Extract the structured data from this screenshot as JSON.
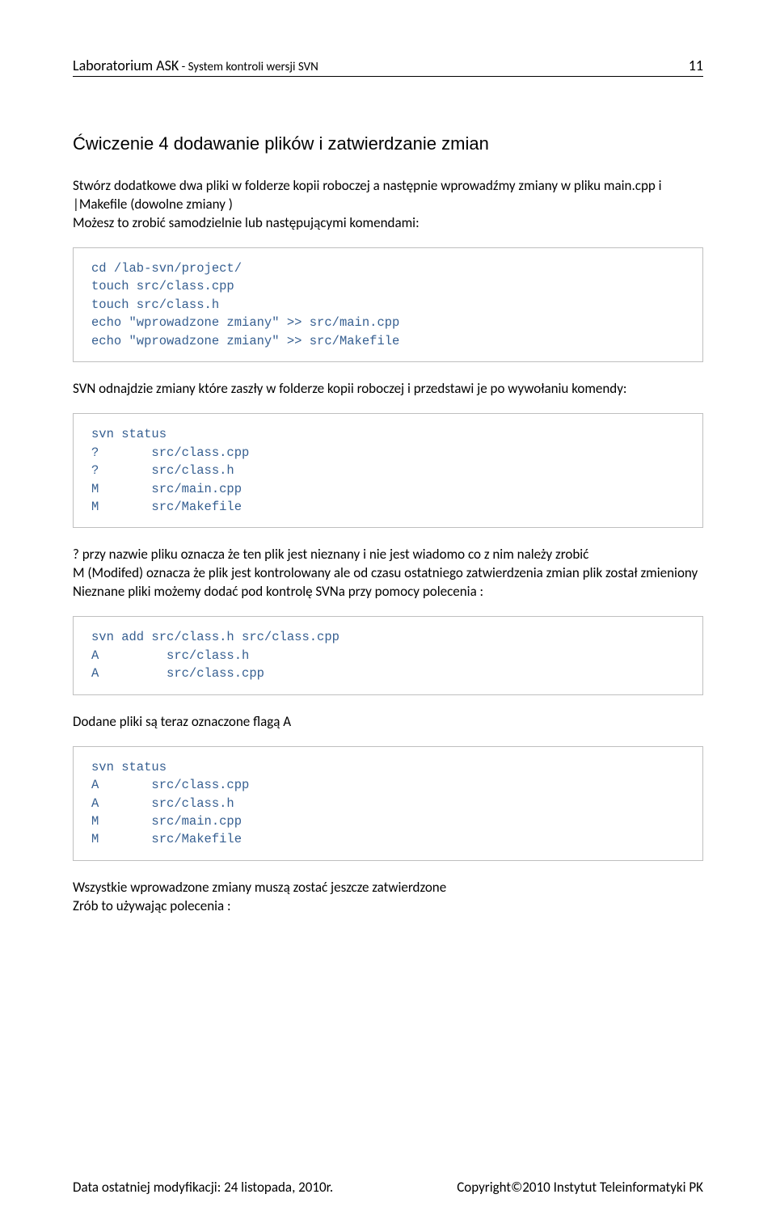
{
  "header": {
    "lab": "Laboratorium ASK",
    "sep": " - ",
    "subtitle": "System kontroli wersji SVN",
    "page": "11"
  },
  "section_title": "Ćwiczenie 4  dodawanie plików i zatwierdzanie zmian",
  "para1": "Stwórz dodatkowe dwa pliki w folderze kopii roboczej a następnie wprowadźmy zmiany w pliku main.cpp i |Makefile (dowolne zmiany )",
  "para2": "Możesz to zrobić samodzielnie lub następującymi komendami:",
  "code1": "cd /lab-svn/project/\ntouch src/class.cpp\ntouch src/class.h\necho \"wprowadzone zmiany\" >> src/main.cpp\necho \"wprowadzone zmiany\" >> src/Makefile",
  "para3": "SVN odnajdzie zmiany które zaszły w folderze kopii roboczej i przedstawi je po wywołaniu komendy:",
  "code2": "svn status\n?       src/class.cpp\n?       src/class.h\nM       src/main.cpp\nM       src/Makefile",
  "para4": "?   przy nazwie pliku oznacza że ten plik jest nieznany i nie jest wiadomo co z nim należy zrobić",
  "para5": "M  (Modifed) oznacza że plik jest kontrolowany ale od czasu ostatniego zatwierdzenia zmian plik został zmieniony",
  "para6": "Nieznane pliki możemy dodać pod kontrolę SVNa przy pomocy polecenia :",
  "code3": "svn add src/class.h src/class.cpp\nA         src/class.h\nA         src/class.cpp",
  "para7": "Dodane pliki są teraz oznaczone flagą A",
  "code4": "svn status\nA       src/class.cpp\nA       src/class.h\nM       src/main.cpp\nM       src/Makefile",
  "para8": "Wszystkie wprowadzone zmiany muszą zostać jeszcze zatwierdzone",
  "para9": "Zrób to używając polecenia :",
  "footer": {
    "left": "Data ostatniej modyfikacji: 24 listopada, 2010r.",
    "right": "Copyright©2010 Instytut Teleinformatyki PK"
  }
}
